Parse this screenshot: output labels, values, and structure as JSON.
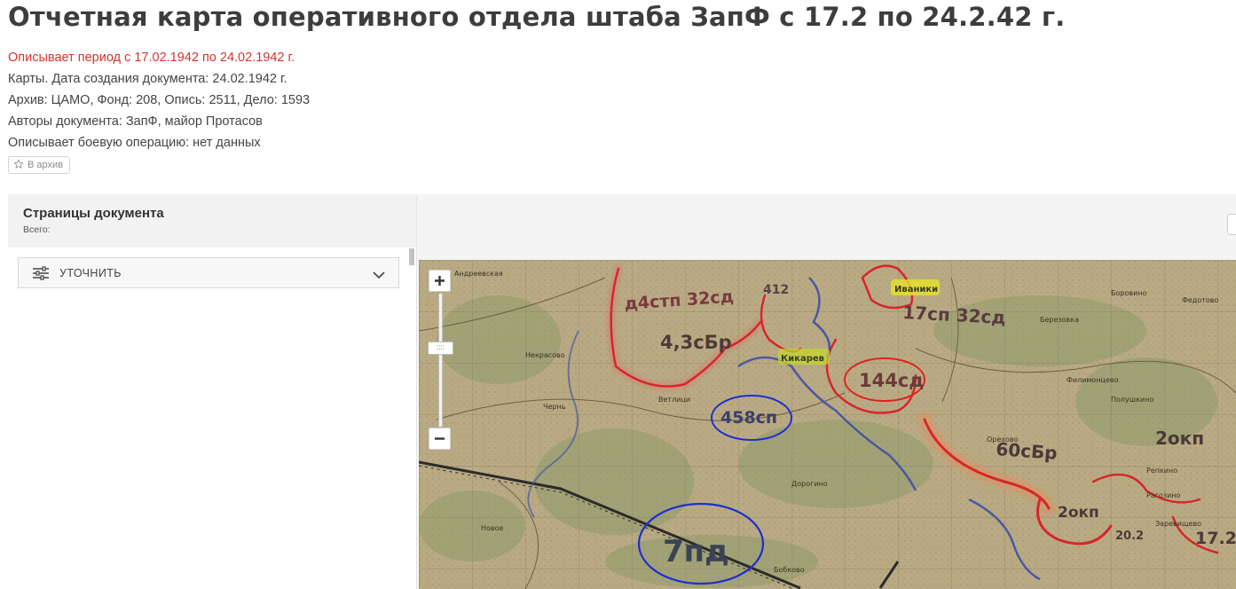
{
  "page": {
    "title": "Отчетная карта оперативного отдела штаба ЗапФ с 17.2 по 24.2.42 г.",
    "period": "Описывает период с 17.02.1942 по 24.02.1942 г.",
    "created": "Карты. Дата создания документа: 24.02.1942 г.",
    "archive": "Архив: ЦАМО, Фонд: 208, Опись: 2511, Дело: 1593",
    "authors": "Авторы документа: ЗапФ, майор Протасов",
    "operation": "Описывает боевую операцию: нет данных",
    "archive_button": "В архив"
  },
  "sidebar": {
    "title": "Страницы документа",
    "subtitle": "Всего:",
    "refine_label": "УТОЧНИТЬ"
  },
  "map": {
    "handle_glyph": "::::",
    "annotations_red": [
      "д4стп 32сд",
      "412",
      "4,3сБр",
      "144сд",
      "60сБр",
      "2окп",
      "2окп",
      "20.2",
      "17.2"
    ],
    "annotations_blue": [
      "458сп",
      "7пд"
    ],
    "annotations_yellow": [
      "Иваники",
      "Кикарев"
    ],
    "annotations_red_extra": [
      "17сп 32сд"
    ],
    "place_names": [
      "Андреевская",
      "Некрасово",
      "Чернь",
      "Ветлици",
      "Дорогино",
      "Бобково",
      "Рагозино",
      "Репкино",
      "Федотово",
      "Филимонцево",
      "Боровино",
      "Березовка",
      "Полушкино",
      "Заревищево",
      "Новое",
      "Орехово"
    ]
  },
  "icons": {
    "star": "star-outline-icon",
    "filter": "sliders-icon",
    "chevron": "chevron-down-icon",
    "plus": "plus-icon",
    "minus": "minus-icon"
  },
  "colors": {
    "accent_red": "#d6332c",
    "map_base": "#b8a882",
    "ink_red": "#d8262a",
    "ink_blue": "#2f3d9e",
    "highlight_yellow": "#e8e22a"
  }
}
